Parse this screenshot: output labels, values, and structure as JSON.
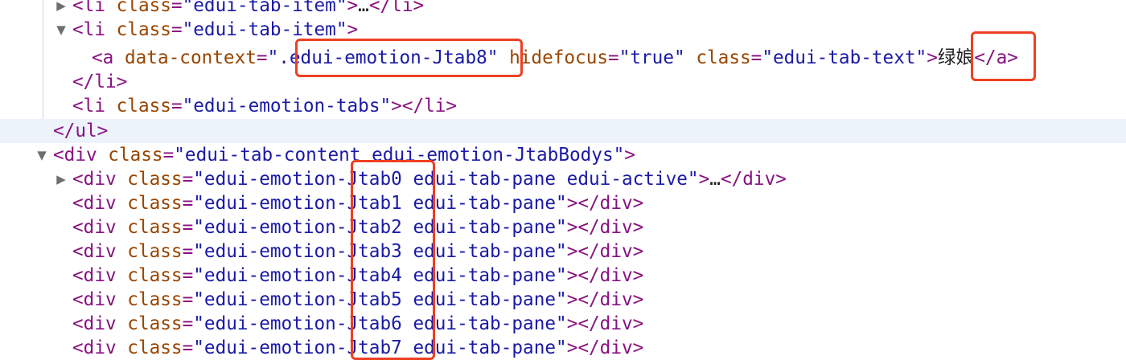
{
  "elements_tree": {
    "lines": [
      {
        "parts": [
          [
            "tag",
            "<li "
          ],
          [
            "attr",
            "class"
          ],
          [
            "tag",
            "="
          ],
          [
            "val",
            "\"edui-tab-item\""
          ],
          [
            "tag",
            ">"
          ],
          [
            "ell",
            "…"
          ],
          [
            "tag",
            "</li>"
          ]
        ]
      },
      {
        "parts": [
          [
            "tag",
            "<li "
          ],
          [
            "attr",
            "class"
          ],
          [
            "tag",
            "="
          ],
          [
            "val",
            "\"edui-tab-item\""
          ],
          [
            "tag",
            ">"
          ]
        ]
      },
      {
        "parts": [
          [
            "tag",
            "<a "
          ],
          [
            "attr",
            "data-context"
          ],
          [
            "tag",
            "="
          ],
          [
            "val",
            "\".edui-emotion-Jtab8\""
          ],
          [
            "tag",
            " "
          ],
          [
            "attr",
            "hidefocus"
          ],
          [
            "tag",
            "="
          ],
          [
            "val",
            "\"true\""
          ],
          [
            "tag",
            " "
          ],
          [
            "attr",
            "class"
          ],
          [
            "tag",
            "="
          ],
          [
            "val",
            "\"edui-tab-text\""
          ],
          [
            "tag",
            ">"
          ],
          [
            "text",
            "绿娘"
          ],
          [
            "tag",
            "</a>"
          ]
        ]
      },
      {
        "parts": [
          [
            "tag",
            "</li>"
          ]
        ]
      },
      {
        "parts": [
          [
            "tag",
            "<li "
          ],
          [
            "attr",
            "class"
          ],
          [
            "tag",
            "="
          ],
          [
            "val",
            "\"edui-emotion-tabs\""
          ],
          [
            "tag",
            "></li>"
          ]
        ]
      },
      {
        "parts": [
          [
            "tag",
            "</ul>"
          ]
        ]
      },
      {
        "parts": [
          [
            "tag",
            "<div "
          ],
          [
            "attr",
            "class"
          ],
          [
            "tag",
            "="
          ],
          [
            "val",
            "\"edui-tab-content edui-emotion-JtabBodys\""
          ],
          [
            "tag",
            ">"
          ]
        ]
      },
      {
        "parts": [
          [
            "tag",
            "<div "
          ],
          [
            "attr",
            "class"
          ],
          [
            "tag",
            "="
          ],
          [
            "val",
            "\"edui-emotion-Jtab0 edui-tab-pane edui-active\""
          ],
          [
            "tag",
            ">"
          ],
          [
            "ell",
            "…"
          ],
          [
            "tag",
            "</div>"
          ]
        ]
      },
      {
        "parts": [
          [
            "tag",
            "<div "
          ],
          [
            "attr",
            "class"
          ],
          [
            "tag",
            "="
          ],
          [
            "val",
            "\"edui-emotion-Jtab1 edui-tab-pane\""
          ],
          [
            "tag",
            "></div>"
          ]
        ]
      },
      {
        "parts": [
          [
            "tag",
            "<div "
          ],
          [
            "attr",
            "class"
          ],
          [
            "tag",
            "="
          ],
          [
            "val",
            "\"edui-emotion-Jtab2 edui-tab-pane\""
          ],
          [
            "tag",
            "></div>"
          ]
        ]
      },
      {
        "parts": [
          [
            "tag",
            "<div "
          ],
          [
            "attr",
            "class"
          ],
          [
            "tag",
            "="
          ],
          [
            "val",
            "\"edui-emotion-Jtab3 edui-tab-pane\""
          ],
          [
            "tag",
            "></div>"
          ]
        ]
      },
      {
        "parts": [
          [
            "tag",
            "<div "
          ],
          [
            "attr",
            "class"
          ],
          [
            "tag",
            "="
          ],
          [
            "val",
            "\"edui-emotion-Jtab4 edui-tab-pane\""
          ],
          [
            "tag",
            "></div>"
          ]
        ]
      },
      {
        "parts": [
          [
            "tag",
            "<div "
          ],
          [
            "attr",
            "class"
          ],
          [
            "tag",
            "="
          ],
          [
            "val",
            "\"edui-emotion-Jtab5 edui-tab-pane\""
          ],
          [
            "tag",
            "></div>"
          ]
        ]
      },
      {
        "parts": [
          [
            "tag",
            "<div "
          ],
          [
            "attr",
            "class"
          ],
          [
            "tag",
            "="
          ],
          [
            "val",
            "\"edui-emotion-Jtab6 edui-tab-pane\""
          ],
          [
            "tag",
            "></div>"
          ]
        ]
      },
      {
        "parts": [
          [
            "tag",
            "<div "
          ],
          [
            "attr",
            "class"
          ],
          [
            "tag",
            "="
          ],
          [
            "val",
            "\"edui-emotion-Jtab7 edui-tab-pane\""
          ],
          [
            "tag",
            "></div>"
          ]
        ]
      }
    ]
  },
  "colors": {
    "tag": "#881280",
    "attribute": "#994500",
    "value": "#1a1aa6",
    "highlight": "#ef3f23",
    "selected_row": "#edf3fb"
  }
}
